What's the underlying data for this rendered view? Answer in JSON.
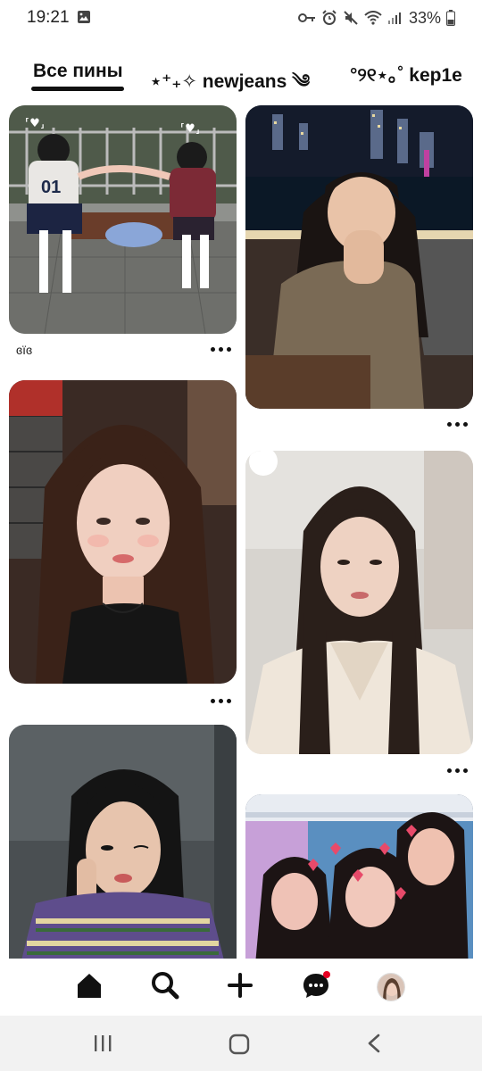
{
  "status_bar": {
    "time": "19:21",
    "battery": "33%"
  },
  "tabs": [
    {
      "label": "Все пины",
      "active": true
    },
    {
      "label": "⋆⁺₊✧ newjeans ༄",
      "active": false
    },
    {
      "label": "°୨୧⋆｡˚ kep1e",
      "active": false
    }
  ],
  "feed": {
    "pins": [
      {
        "id": "pin-1",
        "caption": "ɞïɞ",
        "column": "left"
      },
      {
        "id": "pin-2",
        "caption": "",
        "column": "right"
      },
      {
        "id": "pin-3",
        "caption": "",
        "column": "left"
      },
      {
        "id": "pin-4",
        "caption": "",
        "column": "right"
      },
      {
        "id": "pin-5",
        "caption": "",
        "column": "left"
      },
      {
        "id": "pin-6",
        "caption": "",
        "column": "right"
      }
    ]
  },
  "bottom_nav": {
    "items": [
      {
        "name": "home",
        "icon": "home-icon",
        "active": true
      },
      {
        "name": "search",
        "icon": "search-icon",
        "active": false
      },
      {
        "name": "create",
        "icon": "plus-icon",
        "active": false
      },
      {
        "name": "messages",
        "icon": "chat-icon",
        "active": false,
        "notification": true
      },
      {
        "name": "profile",
        "icon": "avatar",
        "active": false
      }
    ]
  },
  "colors": {
    "accent": "#e60023",
    "text": "#111111",
    "system_nav_bg": "#f2f2f2"
  }
}
